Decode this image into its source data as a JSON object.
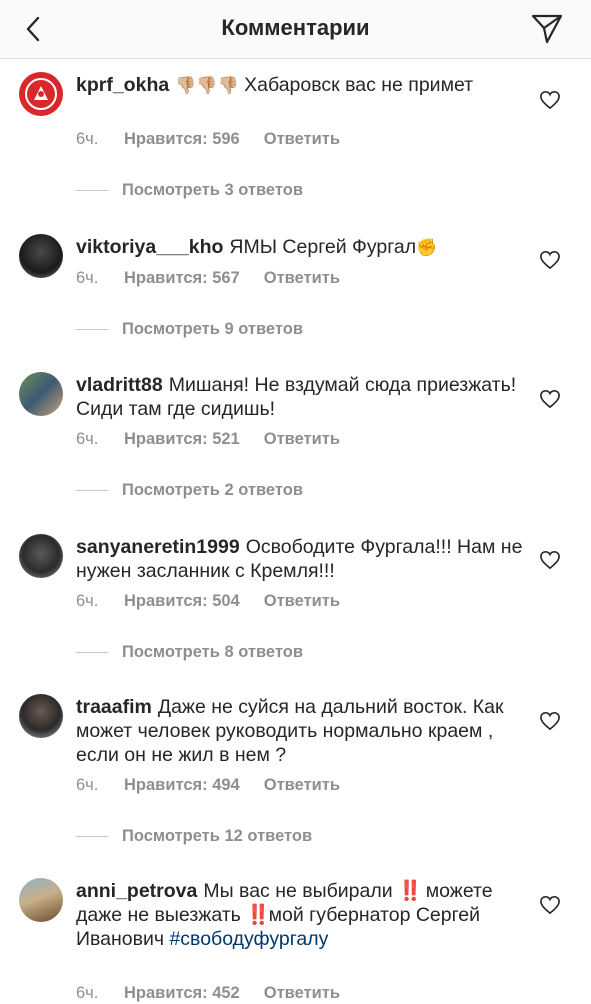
{
  "header": {
    "title": "Комментарии"
  },
  "comments": [
    {
      "username": "kprf_okha",
      "emoji": "👎🏼👎🏼👎🏼",
      "text": "Хабаровск вас не примет",
      "time": "6ч.",
      "likes": "Нравится: 596",
      "reply": "Ответить",
      "view_replies": "Посмотреть 3 ответов"
    },
    {
      "username": "viktoriya___kho",
      "text": "ЯМЫ Сергей Фургал",
      "emoji": "✊",
      "time": "6ч.",
      "likes": "Нравится: 567",
      "reply": "Ответить",
      "view_replies": "Посмотреть 9 ответов"
    },
    {
      "username": "vladritt88",
      "text": "Мишаня! Не вздумай сюда приезжать! Сиди там где сидишь!",
      "time": "6ч.",
      "likes": "Нравится: 521",
      "reply": "Ответить",
      "view_replies": "Посмотреть 2 ответов"
    },
    {
      "username": "sanyaneretin1999",
      "text": "Освободите Фургала!!! Нам не нужен засланник с Кремля!!!",
      "time": "6ч.",
      "likes": "Нравится: 504",
      "reply": "Ответить",
      "view_replies": "Посмотреть 8 ответов"
    },
    {
      "username": "traaafim",
      "text": "Даже не суйся на дальний восток. Как может человек руководить нормально краем , если он не жил в нем ?",
      "time": "6ч.",
      "likes": "Нравится: 494",
      "reply": "Ответить",
      "view_replies": "Посмотреть 12 ответов"
    },
    {
      "username": "anni_petrova",
      "text_1": "Мы вас не выбирали",
      "text_2": "можете даже не выезжать",
      "text_3": "мой губернатор Сергей Иванович",
      "hashtag": "#свободуфургалу",
      "time": "6ч.",
      "likes": "Нравится: 452",
      "reply": "Ответить"
    }
  ],
  "icons": {
    "back": "chevron-left-icon",
    "send": "paper-plane-icon",
    "heart": "heart-outline-icon",
    "double_exclamation": "‼️"
  },
  "colors": {
    "link": "#00376b",
    "muted": "#8e8e8e",
    "accent_red": "#e0183a"
  }
}
